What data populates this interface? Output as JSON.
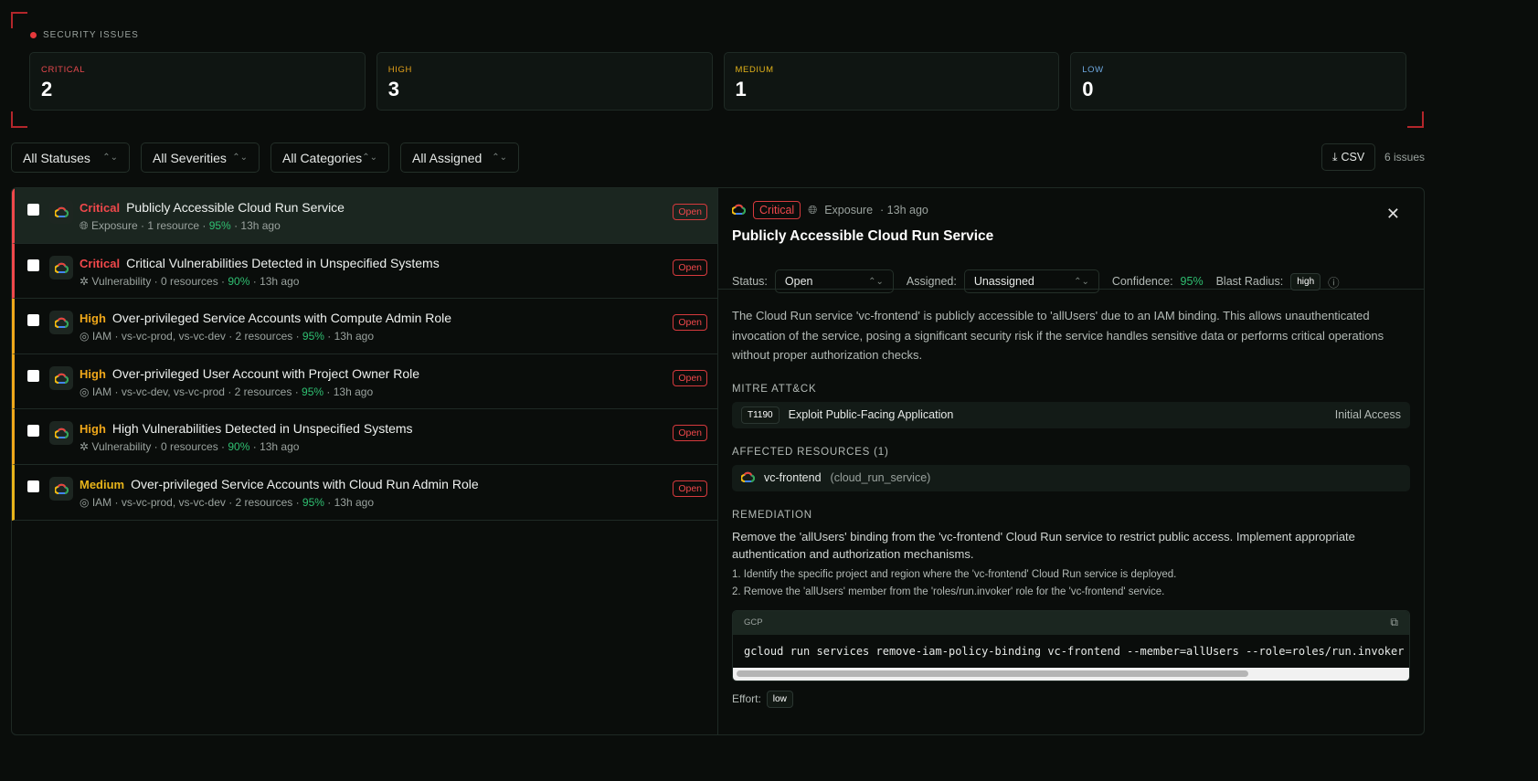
{
  "header": {
    "title": "SECURITY ISSUES"
  },
  "summary": [
    {
      "label": "CRITICAL",
      "value": "2",
      "color": "#e5484d"
    },
    {
      "label": "HIGH",
      "value": "3",
      "color": "#e2a01a"
    },
    {
      "label": "MEDIUM",
      "value": "1",
      "color": "#e2b21a"
    },
    {
      "label": "LOW",
      "value": "0",
      "color": "#6ea8e0"
    }
  ],
  "filters": [
    "All Statuses",
    "All Severities",
    "All Categories",
    "All Assigned"
  ],
  "toolbar": {
    "csv": "CSV",
    "count": "6 issues"
  },
  "issues": [
    {
      "severity": "Critical",
      "sevColor": "#f0484b",
      "title": "Publicly Accessible Cloud Run Service",
      "category": "Exposure",
      "projects": "",
      "resources": "1 resource",
      "confidence": "95%",
      "age": "13h ago",
      "status": "Open"
    },
    {
      "severity": "Critical",
      "sevColor": "#f0484b",
      "title": "Critical Vulnerabilities Detected in Unspecified Systems",
      "category": "Vulnerability",
      "projects": "",
      "resources": "0 resources",
      "confidence": "90%",
      "age": "13h ago",
      "status": "Open"
    },
    {
      "severity": "High",
      "sevColor": "#f0a81a",
      "title": "Over-privileged Service Accounts with Compute Admin Role",
      "category": "IAM",
      "projects": "vs-vc-prod, vs-vc-dev",
      "resources": "2 resources",
      "confidence": "95%",
      "age": "13h ago",
      "status": "Open"
    },
    {
      "severity": "High",
      "sevColor": "#f0a81a",
      "title": "Over-privileged User Account with Project Owner Role",
      "category": "IAM",
      "projects": "vs-vc-dev, vs-vc-prod",
      "resources": "2 resources",
      "confidence": "95%",
      "age": "13h ago",
      "status": "Open"
    },
    {
      "severity": "High",
      "sevColor": "#f0a81a",
      "title": "High Vulnerabilities Detected in Unspecified Systems",
      "category": "Vulnerability",
      "projects": "",
      "resources": "0 resources",
      "confidence": "90%",
      "age": "13h ago",
      "status": "Open"
    },
    {
      "severity": "Medium",
      "sevColor": "#e8b41a",
      "title": "Over-privileged Service Accounts with Cloud Run Admin Role",
      "category": "IAM",
      "projects": "vs-vc-prod, vs-vc-dev",
      "resources": "2 resources",
      "confidence": "95%",
      "age": "13h ago",
      "status": "Open"
    }
  ],
  "detail": {
    "severity": "Critical",
    "category": "Exposure",
    "age": "· 13h ago",
    "title": "Publicly Accessible Cloud Run Service",
    "status_label": "Status:",
    "status": "Open",
    "assigned_label": "Assigned:",
    "assigned": "Unassigned",
    "confidence_label": "Confidence:",
    "confidence": "95%",
    "blast_label": "Blast Radius:",
    "blast": "high",
    "description": "The Cloud Run service 'vc-frontend' is publicly accessible to 'allUsers' due to an IAM binding. This allows unauthenticated invocation of the service, posing a significant security risk if the service handles sensitive data or performs critical operations without proper authorization checks.",
    "mitre_heading": "MITRE ATT&CK",
    "mitre": {
      "id": "T1190",
      "name": "Exploit Public-Facing Application",
      "tactic": "Initial Access"
    },
    "resources_heading": "AFFECTED RESOURCES (1)",
    "resource": {
      "name": "vc-frontend",
      "type": "(cloud_run_service)"
    },
    "remediation_heading": "REMEDIATION",
    "remediation": "Remove the 'allUsers' binding from the 'vc-frontend' Cloud Run service to restrict public access. Implement appropriate authentication and authorization mechanisms.",
    "steps": [
      "1. Identify the specific project and region where the 'vc-frontend' Cloud Run service is deployed.",
      "2. Remove the 'allUsers' member from the 'roles/run.invoker' role for the 'vc-frontend' service."
    ],
    "code_lang": "GCP",
    "code": "gcloud run services remove-iam-policy-binding vc-frontend --member=allUsers --role=roles/run.invoker --region",
    "effort_label": "Effort:",
    "effort": "low"
  }
}
